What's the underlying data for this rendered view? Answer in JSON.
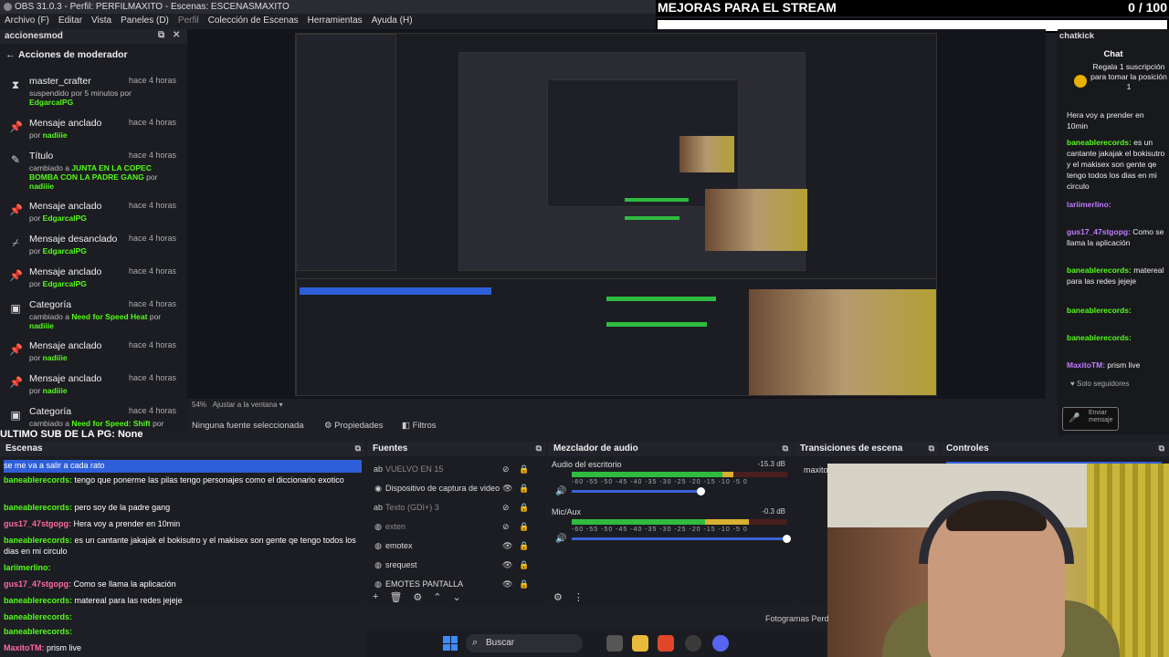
{
  "window": {
    "title": "OBS 31.0.3 - Perfil: PERFILMAXITO - Escenas: ESCENASMAXITO"
  },
  "menu": [
    "Archivo (F)",
    "Editar",
    "Vista",
    "Paneles (D)",
    "Perfil",
    "Colección de Escenas",
    "Herramientas",
    "Ayuda (H)"
  ],
  "banner": {
    "title": "MEJORAS PARA EL STREAM",
    "count": "0",
    "total": "/ 100"
  },
  "moderator": {
    "dock_title": "accionesmod",
    "title": "Acciones de moderador",
    "items": [
      {
        "icon": "hourglass-icon",
        "glyph": "⧗",
        "title": "master_crafter",
        "time": "hace 4 horas",
        "sub_pre": "suspendido por 5 minutos por",
        "sub_user": "EdgarcalPG",
        "sub_post": ""
      },
      {
        "icon": "pin-icon",
        "glyph": "📌",
        "title": "Mensaje anclado",
        "time": "hace 4 horas",
        "sub_pre": "por",
        "sub_user": "nadiiie",
        "sub_post": ""
      },
      {
        "icon": "title-edit-icon",
        "glyph": "✎",
        "title": "Título",
        "time": "hace 4 horas",
        "sub_pre": "cambiado a",
        "sub_user": "JUNTA EN LA COPEC BOMBA CON LA PADRE GANG",
        "sub_post": "por",
        "sub_user2": "nadiiie"
      },
      {
        "icon": "pin-icon",
        "glyph": "📌",
        "title": "Mensaje anclado",
        "time": "hace 4 horas",
        "sub_pre": "por",
        "sub_user": "EdgarcalPG",
        "sub_post": ""
      },
      {
        "icon": "unpin-icon",
        "glyph": "⌿",
        "title": "Mensaje desanclado",
        "time": "hace 4 horas",
        "sub_pre": "por",
        "sub_user": "EdgarcalPG",
        "sub_post": ""
      },
      {
        "icon": "pin-icon",
        "glyph": "📌",
        "title": "Mensaje anclado",
        "time": "hace 4 horas",
        "sub_pre": "por",
        "sub_user": "EdgarcalPG",
        "sub_post": ""
      },
      {
        "icon": "category-icon",
        "glyph": "▣",
        "title": "Categoría",
        "time": "hace 4 horas",
        "sub_pre": "cambiado a",
        "sub_user": "Need for Speed Heat",
        "sub_post": "por",
        "sub_user2": "nadiiie"
      },
      {
        "icon": "pin-icon",
        "glyph": "📌",
        "title": "Mensaje anclado",
        "time": "hace 4 horas",
        "sub_pre": "por",
        "sub_user": "nadiiie",
        "sub_post": ""
      },
      {
        "icon": "pin-icon",
        "glyph": "📌",
        "title": "Mensaje anclado",
        "time": "hace 4 horas",
        "sub_pre": "por",
        "sub_user": "nadiiie",
        "sub_post": ""
      },
      {
        "icon": "category-icon",
        "glyph": "▣",
        "title": "Categoría",
        "time": "hace 4 horas",
        "sub_pre": "cambiado a",
        "sub_user": "Need for Speed: Shift",
        "sub_post": "por",
        "sub_user2": ""
      }
    ]
  },
  "ultimo_sub": "ULTIMO SUB DE LA PG: None",
  "preview": {
    "zoom": "54%",
    "fit": "Ajustar a la ventana"
  },
  "source_bar": {
    "no_source": "Ninguna fuente seleccionada",
    "properties": "Propiedades",
    "filters": "Filtros"
  },
  "chat": {
    "dock_title": "chatkick",
    "title": "Chat",
    "pinned": "Regala 1 suscripción para tomar la posición 1",
    "messages": [
      {
        "user": "",
        "text": "Hera voy a prender en 10min"
      },
      {
        "user": "baneablerecords:",
        "text": "es un cantante jakajak el bokisutro y el makisex son gente qe tengo todos los dias en mi circulo"
      },
      {
        "user": "lariimerlino:",
        "text": ""
      },
      {
        "user": "gus17_47stgopg:",
        "text": "Como se llama la aplicación"
      },
      {
        "user": "baneablerecords:",
        "text": "matereal para las redes jejeje"
      },
      {
        "user": "baneablerecords:",
        "text": ""
      },
      {
        "user": "baneablerecords:",
        "text": ""
      },
      {
        "user": "MaxitoTM:",
        "text": "prism live"
      }
    ],
    "followers_only": "Solo seguidores",
    "send": "Enviar mensaje"
  },
  "docks": {
    "scenes": "Escenas",
    "sources": "Fuentes",
    "mixer": "Mezclador de audio",
    "transitions": "Transiciones de escena",
    "controls": "Controles",
    "transition_name": "maxito"
  },
  "bottom_chat": [
    {
      "user": "",
      "text": "se me va a salir a cada rato",
      "highlight": true
    },
    {
      "user": "baneablerecords:",
      "text": "tengo que ponerme las pilas tengo personajes como el diccionario exotico"
    },
    {
      "user": "baneablerecords:",
      "text": "pero soy de la padre gang"
    },
    {
      "user": "gus17_47stgopg:",
      "text": "Hera voy a prender en 10min",
      "pink": true
    },
    {
      "user": "baneablerecords:",
      "text": "es un cantante jakajak el bokisutro y el makisex son gente qe tengo todos los dias en mi circulo"
    },
    {
      "user": "lariimerlino:",
      "text": ""
    },
    {
      "user": "gus17_47stgopg:",
      "text": "Como se llama la aplicación",
      "pink": true
    },
    {
      "user": "baneablerecords:",
      "text": "matereal para las redes jejeje"
    },
    {
      "user": "baneablerecords:",
      "text": ""
    },
    {
      "user": "baneablerecords:",
      "text": ""
    },
    {
      "user": "MaxitoTM:",
      "text": "prism live",
      "pink": true
    }
  ],
  "sources": [
    {
      "icon": "text-icon",
      "glyph": "ab",
      "name": "VUELVO EN 15",
      "visible": false
    },
    {
      "icon": "capture-device-icon",
      "glyph": "◉",
      "name": "Dispositivo de captura de video",
      "visible": true
    },
    {
      "icon": "text-icon",
      "glyph": "ab",
      "name": "Texto (GDI+) 3",
      "visible": false
    },
    {
      "icon": "browser-icon",
      "glyph": "◍",
      "name": "exten",
      "visible": false
    },
    {
      "icon": "browser-icon",
      "glyph": "◍",
      "name": "emotex",
      "visible": true
    },
    {
      "icon": "browser-icon",
      "glyph": "◍",
      "name": "srequest",
      "visible": true
    },
    {
      "icon": "browser-icon",
      "glyph": "◍",
      "name": "EMOTES PANTALLA",
      "visible": true
    }
  ],
  "mixer": [
    {
      "name": "Audio del escritorio",
      "db": "-15.3 dB",
      "level": 0.7,
      "yellow": 0.05,
      "fader": 0.6
    },
    {
      "name": "Mic/Aux",
      "db": "-0.3 dB",
      "level": 0.62,
      "yellow": 0.2,
      "fader": 1.0
    }
  ],
  "mixer_ticks": "-60 -55 -50 -45 -40 -35 -30 -25 -20 -15 -10 -5 0",
  "taskbar": {
    "search": "Buscar"
  },
  "fotogramas": "Fotogramas Perd",
  "colors": {
    "kick_green": "#53fc18",
    "accent_blue": "#2f5fd8",
    "chat_purple": "#c07cff"
  }
}
